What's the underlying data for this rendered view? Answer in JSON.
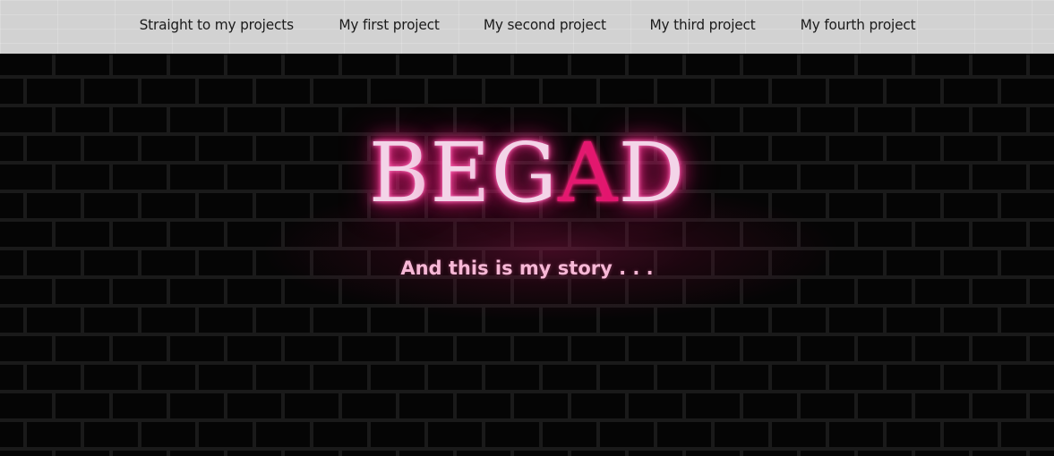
{
  "nav": {
    "items": [
      {
        "label": "Straight to my projects"
      },
      {
        "label": "My first project"
      },
      {
        "label": "My second project"
      },
      {
        "label": "My third project"
      },
      {
        "label": "My fourth project"
      }
    ]
  },
  "hero": {
    "title_letters": [
      "B",
      "E",
      "G",
      "A",
      "D"
    ],
    "subtitle": "And this is my story . . ."
  },
  "colors": {
    "navbar_bg": "#d2d2d2",
    "wall_bg": "#050505",
    "brick_mortar": "#1a1a1a",
    "neon_pink": "#ff1f86",
    "accent_letter": "#e3186f",
    "subtitle": "#f7b8d6"
  }
}
